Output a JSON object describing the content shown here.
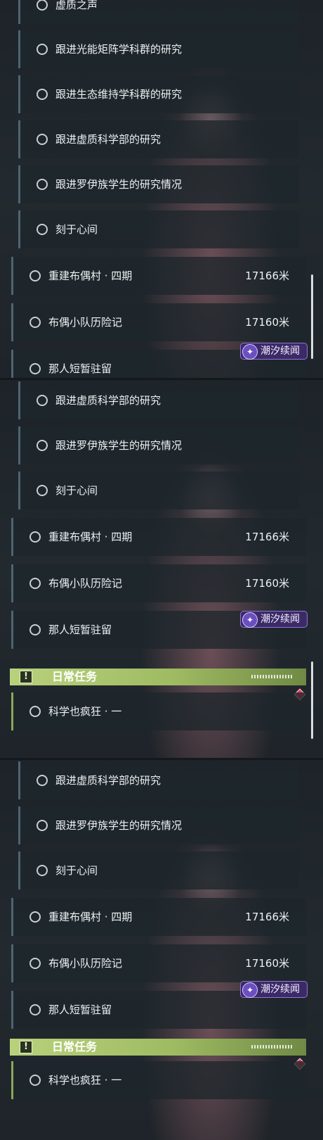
{
  "panel1": {
    "partial_top_label": "虚质之声",
    "sub_items": [
      "跟进光能矩阵学科群的研究",
      "跟进生态维持学科群的研究",
      "跟进虚质科学部的研究",
      "跟进罗伊族学生的研究情况",
      "刻于心间"
    ],
    "main_items": [
      {
        "label": "重建布偶村 · 四期",
        "dist": "17166米"
      },
      {
        "label": "布偶小队历险记",
        "dist": "17160米"
      }
    ],
    "partial_bottom_label": "那人短暂驻留"
  },
  "panel2": {
    "sub_items": [
      "跟进虚质科学部的研究",
      "跟进罗伊族学生的研究情况",
      "刻于心间"
    ],
    "main_items": [
      {
        "label": "重建布偶村 · 四期",
        "dist": "17166米"
      },
      {
        "label": "布偶小队历险记",
        "dist": "17160米"
      },
      {
        "label": "那人短暂驻留",
        "dist": ""
      }
    ],
    "daily_header": "日常任务",
    "daily_items": [
      "科学也疯狂 · 一"
    ]
  },
  "panel3": {
    "sub_items": [
      "跟进虚质科学部的研究",
      "跟进罗伊族学生的研究情况",
      "刻于心间"
    ],
    "main_items": [
      {
        "label": "重建布偶村 · 四期",
        "dist": "17166米"
      },
      {
        "label": "布偶小队历险记",
        "dist": "17160米"
      },
      {
        "label": "那人短暂驻留",
        "dist": ""
      }
    ],
    "daily_header": "日常任务",
    "daily_items": [
      "科学也疯狂 · 一"
    ]
  },
  "badge": {
    "text": "潮汐续闻"
  },
  "icons": {
    "header_icon": "exclamation-icon",
    "item_icon": "ring-icon",
    "badge_icon": "feather-icon",
    "marker_icon": "diamond-marker-icon"
  },
  "colors": {
    "accent_green": "#b8d27c",
    "badge_purple": "#3c2a68",
    "marker_red": "#e0405a"
  }
}
